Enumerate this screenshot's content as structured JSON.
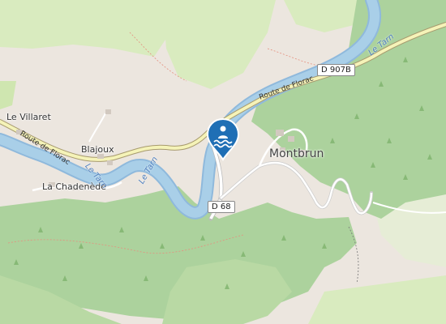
{
  "map": {
    "colors": {
      "background": "#ece6df",
      "meadow": "#d9ebbf",
      "forest": "#acd29d",
      "river": "#a9cfe8",
      "river_edge": "#8fb9dc",
      "road_major": "#f5f3b8",
      "road_minor": "#ffffff",
      "pin": "#1f6fb5"
    },
    "places": {
      "le_villaret": "Le Villaret",
      "blajoux": "Blajoux",
      "la_chadenede": "La Chadenède",
      "montbrun": "Montbrun"
    },
    "rivers": {
      "tarn_east": "Le Tarn",
      "tarn_center": "Le Tarn",
      "tarn_west": "Le Tarn"
    },
    "roads": {
      "route_florac_east": "Route de Florac",
      "route_florac_west": "Route de Florac",
      "d907b": "D 907B",
      "d68": "D 68"
    },
    "marker": {
      "icon": "swimming-icon",
      "color": "#1f6fb5"
    }
  }
}
